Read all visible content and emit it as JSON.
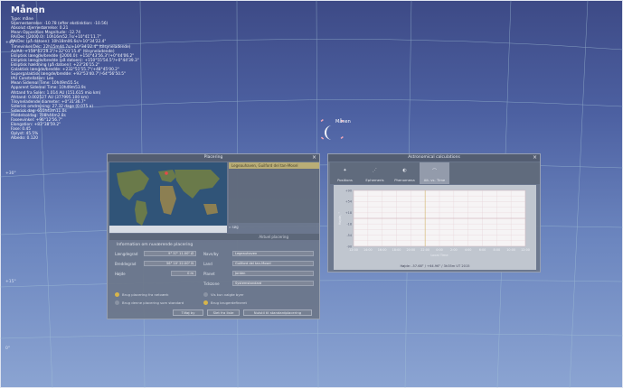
{
  "infobox": {
    "title": "Månen",
    "lines": [
      "Type: måne",
      "Stjernestørrelse: -10.78 (efter ekstinktion: -10.56)",
      "Absolut stjernestørrelse: 0.21",
      "Mean Opposition Magnitude: -12.74",
      "RA/Dec (J2000.0): 10h16m52.7s/+10°41'11.7\"",
      "RA/Dec (på datoen): 10h18m06.6s/+10°34'22.4\"",
      "Timevinkel/Dec: 22h15m44.7s/+10°34'22.4\" (tilsyneladende)",
      "Az/Alt: +158°43'29.3\"/+32°01'15.4\" (tilsyneladende)",
      "Ekliptisk længde/bredde (J2000.0): +150°43'56.3\"/+0°44'06.2\"",
      "Ekliptisk længde/bredde (på datoen): +150°55'54.5\"/+0°44'39.3\"",
      "Ekliptisk hældning (på datoen): +23°26'15.2\"",
      "Galaktisk længde/bredde: +232°51'55.7\"/+48°45'00.2\"",
      "Supergalaktisk længde/bredde: +93°53'40.7\"/-64°56'50.5\"",
      "IAU Constellation: Leo",
      "Mean Sidereal Time: 10h49m55.5s",
      "Apparent Sidereal Time: 10h49m53.9s",
      "Afstand fra Solen: 1.014 AU (151.615 mio km)",
      "Afstand: 0.002527 AU (377995.100 km)",
      "Tilsyneladende diameter: +0°31'36.7\"",
      "Siderisk omdrejning: 27.32 dage (0.075 a)",
      "Siderisk dag: 655h43m11.0s",
      "Middelsoldag: 708h44m2.8s",
      "Faseevinkel: +96°12'56.7\"",
      "Elongation: +83°38'59.2\"",
      "Fase: 0.45",
      "Oplyst: 45.5%",
      "Albedo: 0.120"
    ]
  },
  "sky": {
    "moon_label": "Månen",
    "grid_labels": [
      "+45°",
      "+30°",
      "+15°",
      "0°"
    ]
  },
  "planet_window": {
    "title": "Placering",
    "close": "×",
    "list_header": "Legeauhaven, Guilford del tan-Mosel",
    "search_placeholder": "søg",
    "current_location_label": "Aktuel placering",
    "section_title": "Information om nuværende placering",
    "fields": [
      {
        "label": "Længdegrad",
        "value": "9° 57' 11.00\" Ø"
      },
      {
        "label": "Breddegrad",
        "value": "56° 10' 22.00\" N"
      },
      {
        "label": "Højde",
        "value": "0 m"
      }
    ],
    "right_fields": [
      {
        "label": "Navn/by",
        "value": "Legeauhaven"
      },
      {
        "label": "Land",
        "value": "Guilford del tan-Mosel"
      },
      {
        "label": "Planet",
        "value": "Jorden"
      },
      {
        "label": "Tidszone",
        "value": "Systemstandard"
      }
    ],
    "checks": [
      {
        "label": "Brug placering fra netværk",
        "on": true
      },
      {
        "label": "Brug denne placering som standard",
        "on": false
      },
      {
        "label": "Vis kun valgte byer",
        "on": false
      },
      {
        "label": "Brug brugerdefineret",
        "on": true
      }
    ],
    "buttons": [
      "Tilføj by",
      "Slet fra liste",
      "Nulstil til standardplacering"
    ]
  },
  "astro_window": {
    "title": "Astronomical calculations",
    "close": "×",
    "tabs": [
      {
        "label": "Positions",
        "icon": "positions-icon",
        "glyph": "✦"
      },
      {
        "label": "Ephemeris",
        "icon": "ephemeris-icon",
        "glyph": "⋰"
      },
      {
        "label": "Phenomena",
        "icon": "phenomena-icon",
        "glyph": "◐"
      },
      {
        "label": "Alt. vs. Time",
        "icon": "altitude-icon",
        "glyph": "⌒"
      }
    ],
    "active_tab": 3,
    "footer": "Højde: -57.68° / +64.96° / 3h35m UT 2015"
  },
  "chart_data": {
    "type": "line",
    "ylabel": "Højde, °",
    "xlabel": "Local Time",
    "ylim": [
      -90,
      90
    ],
    "yticks": [
      "+90",
      "+72",
      "+54",
      "+36",
      "+18",
      "0",
      "-18",
      "-36",
      "-54",
      "-72",
      "-90"
    ],
    "xticks": [
      "12:00",
      "14:00",
      "16:00",
      "18:00",
      "20:00",
      "22:00",
      "0:00",
      "2:00",
      "4:00",
      "6:00",
      "8:00",
      "10:00",
      "12:00"
    ],
    "grid": true,
    "series": [],
    "marker_x": "22:00"
  }
}
